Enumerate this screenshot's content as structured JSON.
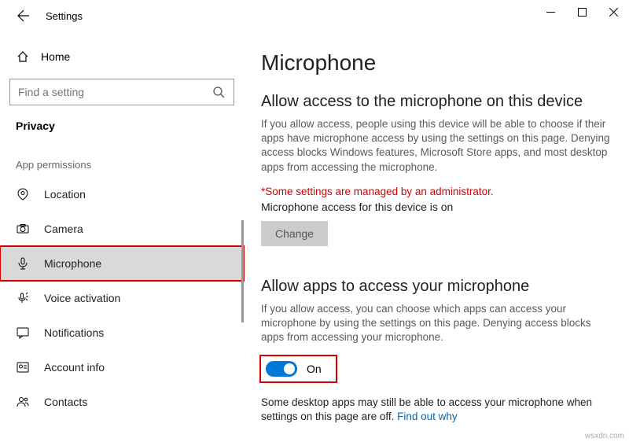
{
  "window": {
    "title": "Settings"
  },
  "sidebar": {
    "home": "Home",
    "searchPlaceholder": "Find a setting",
    "section": "Privacy",
    "group": "App permissions",
    "items": [
      {
        "label": "Location"
      },
      {
        "label": "Camera"
      },
      {
        "label": "Microphone"
      },
      {
        "label": "Voice activation"
      },
      {
        "label": "Notifications"
      },
      {
        "label": "Account info"
      },
      {
        "label": "Contacts"
      }
    ]
  },
  "main": {
    "title": "Microphone",
    "section1": {
      "heading": "Allow access to the microphone on this device",
      "body": "If you allow access, people using this device will be able to choose if their apps have microphone access by using the settings on this page. Denying access blocks Windows features, Microsoft Store apps, and most desktop apps from accessing the microphone.",
      "adminNote": "*Some settings are managed by an administrator.",
      "status": "Microphone access for this device is on",
      "changeBtn": "Change"
    },
    "section2": {
      "heading": "Allow apps to access your microphone",
      "body": "If you allow access, you can choose which apps can access your microphone by using the settings on this page. Denying access blocks apps from accessing your microphone.",
      "toggleLabel": "On",
      "footnote": "Some desktop apps may still be able to access your microphone when settings on this page are off. ",
      "footnoteLink": "Find out why"
    }
  },
  "watermark": "wsxdn.com"
}
